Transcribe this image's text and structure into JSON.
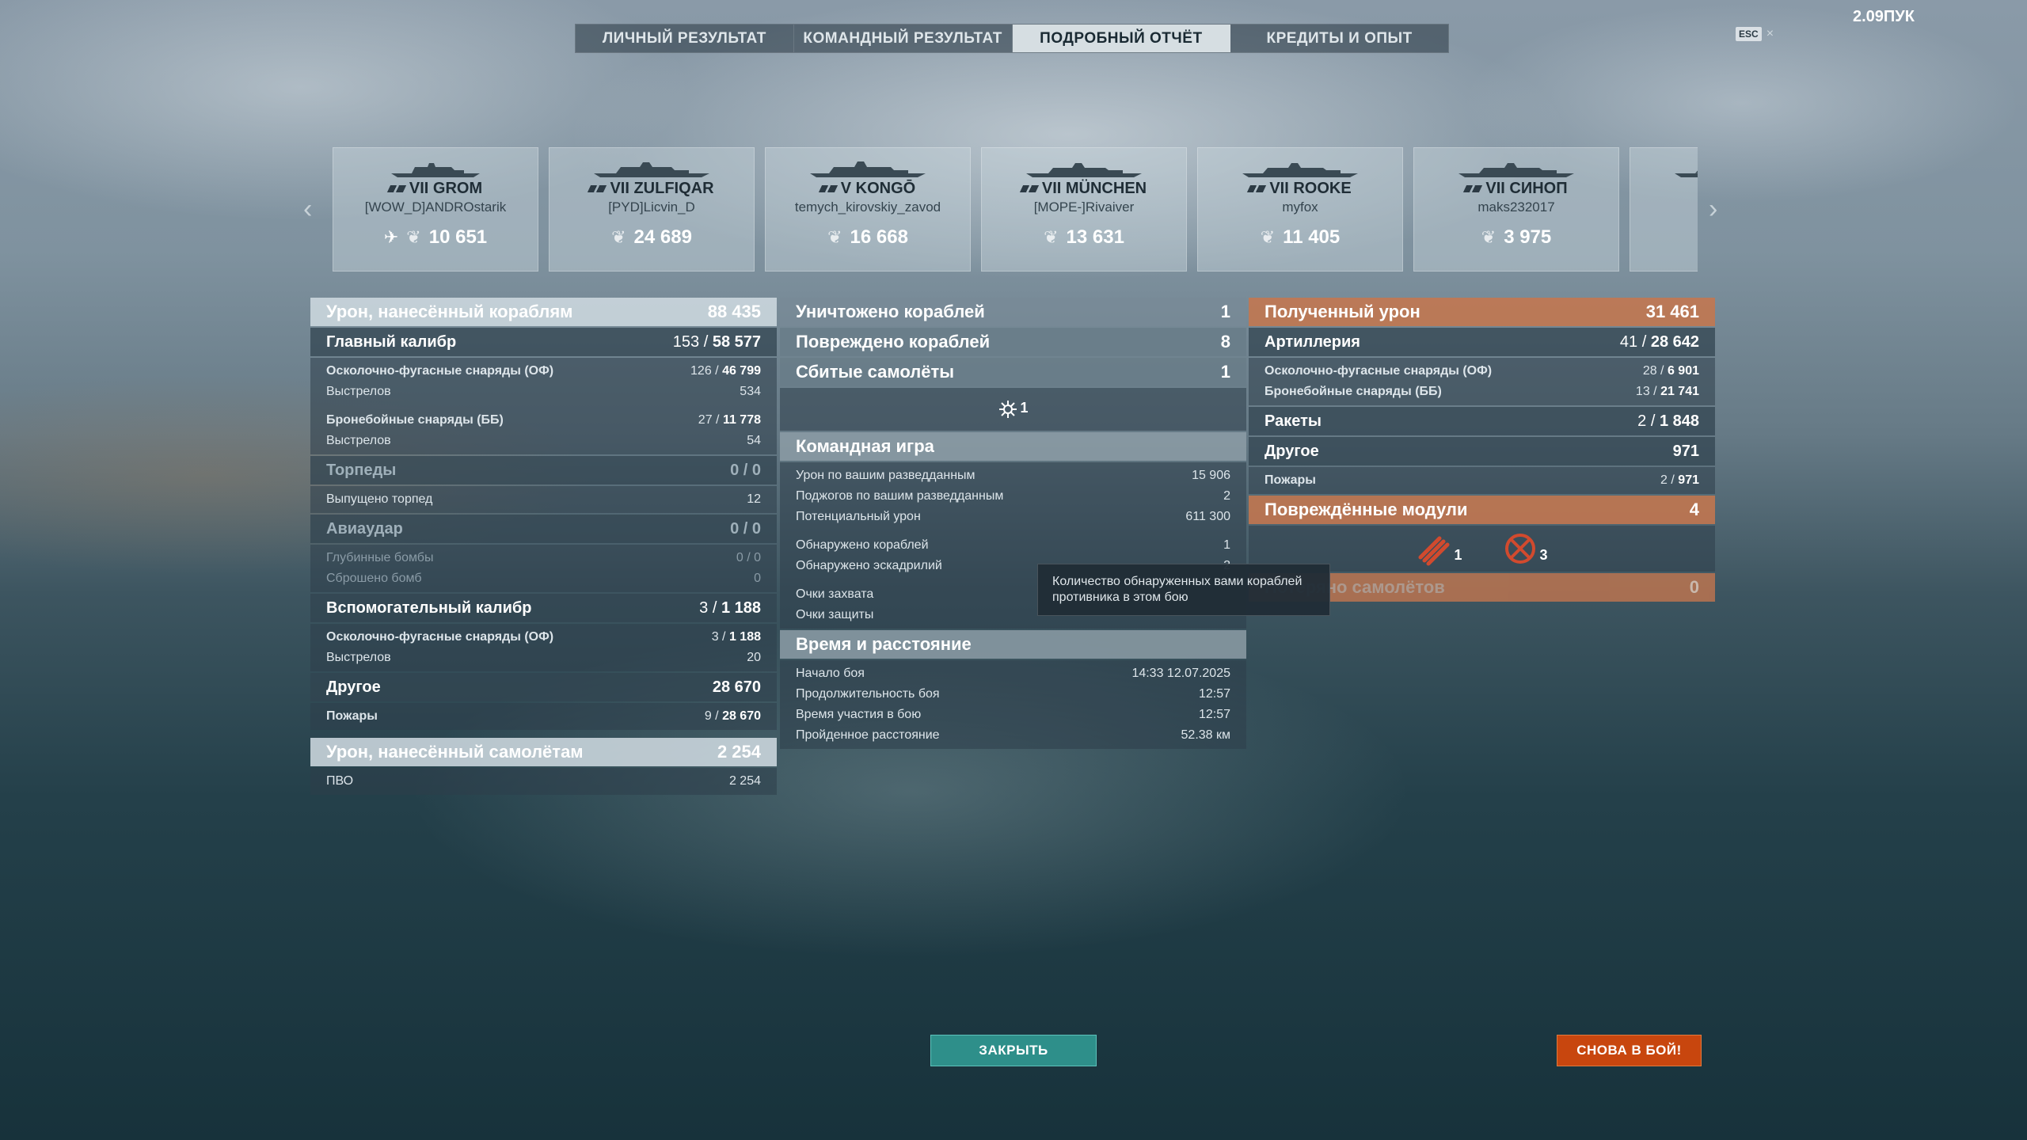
{
  "tabs": [
    "ЛИЧНЫЙ РЕЗУЛЬТАТ",
    "КОМАНДНЫЙ РЕЗУЛЬТАТ",
    "ПОДРОБНЫЙ ОТЧЁТ",
    "КРЕДИТЫ И ОПЫТ"
  ],
  "active_tab": "ПОДРОБНЫЙ ОТЧЁТ",
  "esc_key": "ESC",
  "top_right_text": "2.09ПУК",
  "ships": [
    {
      "tier_name": "VII GROM",
      "player": "[WOW_D]ANDROstarik",
      "score": "10 651"
    },
    {
      "tier_name": "VII ZULFIQAR",
      "player": "[PYD]Licvin_D",
      "score": "24 689"
    },
    {
      "tier_name": "V KONGŌ",
      "player": "temych_kirovskiy_zavod",
      "score": "16 668"
    },
    {
      "tier_name": "VII MÜNCHEN",
      "player": "[MOPE-]Rivaiver",
      "score": "13 631"
    },
    {
      "tier_name": "VII ROOKE",
      "player": "myfox",
      "score": "11 405"
    },
    {
      "tier_name": "VII СИНОП",
      "player": "maks232017",
      "score": "3 975"
    }
  ],
  "left": {
    "damage_ships": {
      "label": "Урон, нанесённый кораблям",
      "value": "88 435"
    },
    "main_caliber": {
      "label": "Главный калибр",
      "hits": "153",
      "dmg": "58 577"
    },
    "he_shells": {
      "label": "Осколочно-фугасные снаряды (ОФ)",
      "hits": "126",
      "dmg": "46 799"
    },
    "he_shots": {
      "label": "Выстрелов",
      "value": "534"
    },
    "ap_shells": {
      "label": "Бронебойные снаряды (ББ)",
      "hits": "27",
      "dmg": "11 778"
    },
    "ap_shots": {
      "label": "Выстрелов",
      "value": "54"
    },
    "torpedoes": {
      "label": "Торпеды",
      "value": "0 / 0"
    },
    "torp_launched": {
      "label": "Выпущено торпед",
      "value": "12"
    },
    "air_strike": {
      "label": "Авиаудар",
      "value": "0 / 0"
    },
    "depth_charges": {
      "label": "Глубинные бомбы",
      "value": "0 / 0"
    },
    "bombs_dropped": {
      "label": "Сброшено бомб",
      "value": "0"
    },
    "secondary": {
      "label": "Вспомогательный калибр",
      "hits": "3",
      "dmg": "1 188"
    },
    "sec_he": {
      "label": "Осколочно-фугасные снаряды (ОФ)",
      "hits": "3",
      "dmg": "1 188"
    },
    "sec_shots": {
      "label": "Выстрелов",
      "value": "20"
    },
    "other": {
      "label": "Другое",
      "value": "28 670"
    },
    "fires": {
      "label": "Пожары",
      "hits": "9",
      "dmg": "28 670"
    },
    "damage_planes": {
      "label": "Урон, нанесённый самолётам",
      "value": "2 254"
    },
    "aa": {
      "label": "ПВО",
      "value": "2 254"
    }
  },
  "middle": {
    "destroyed": {
      "label": "Уничтожено кораблей",
      "value": "1"
    },
    "damaged": {
      "label": "Повреждено кораблей",
      "value": "8"
    },
    "planes_shot": {
      "label": "Сбитые самолёты",
      "value": "1"
    },
    "plane_icon_count": "1",
    "team_game": {
      "label": "Командная игра",
      "rows": [
        {
          "label": "Урон по вашим разведданным",
          "value": "15 906"
        },
        {
          "label": "Поджогов по вашим разведданным",
          "value": "2"
        },
        {
          "label": "Потенциальный урон",
          "value": "611 300"
        }
      ],
      "rows2": [
        {
          "label": "Обнаружено кораблей",
          "value": "1"
        },
        {
          "label": "Обнаружено эскадрилий",
          "value": "2"
        }
      ],
      "rows3": [
        {
          "label": "Очки захвата",
          "value": ""
        },
        {
          "label": "Очки защиты",
          "value": ""
        }
      ]
    },
    "time_distance": {
      "label": "Время и расстояние",
      "rows": [
        {
          "label": "Начало боя",
          "value": "14:33  12.07.2025"
        },
        {
          "label": "Продолжительность боя",
          "value": "12:57"
        },
        {
          "label": "Время участия в бою",
          "value": "12:57"
        },
        {
          "label": "Пройденное расстояние",
          "value": "52.38 км"
        }
      ]
    }
  },
  "right": {
    "received": {
      "label": "Полученный урон",
      "value": "31 461"
    },
    "artillery": {
      "label": "Артиллерия",
      "hits": "41",
      "dmg": "28 642"
    },
    "he": {
      "label": "Осколочно-фугасные снаряды (ОФ)",
      "hits": "28",
      "dmg": "6 901"
    },
    "ap": {
      "label": "Бронебойные снаряды (ББ)",
      "hits": "13",
      "dmg": "21 741"
    },
    "rockets": {
      "label": "Ракеты",
      "hits": "2",
      "dmg": "1 848"
    },
    "other": {
      "label": "Другое",
      "value": "971"
    },
    "fires": {
      "label": "Пожары",
      "hits": "2",
      "dmg": "971"
    },
    "modules": {
      "label": "Повреждённые модули",
      "value": "4"
    },
    "module_counts": [
      "1",
      "3"
    ],
    "planes_lost": {
      "label": "Потеряно самолётов",
      "value": "0"
    }
  },
  "tooltip": "Количество обнаруженных вами кораблей противника в этом бою",
  "buttons": {
    "close": "ЗАКРЫТЬ",
    "battle": "СНОВА В БОЙ!"
  }
}
